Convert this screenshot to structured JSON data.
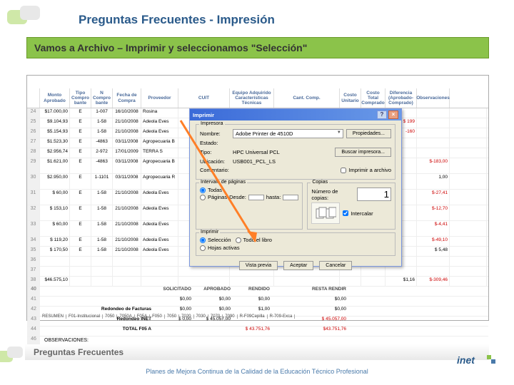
{
  "title": "Preguntas Frecuentes - Impresión",
  "instruction": "Vamos a Archivo – Imprimir y seleccionamos \"Selección\"",
  "headers": [
    "",
    "Monto Aprobado",
    "Tipo Compro bante",
    "N Compro bante",
    "Fecha de Compra",
    "Proveedor",
    "CUIT",
    "Equipo Adquirido Características Técnicas",
    "Cant. Comp.",
    "Costo Unitario",
    "Costo Total Comprado",
    "Diferencia (Aprobado-Comprado)",
    "Observaciones"
  ],
  "rows": [
    {
      "rn": "24",
      "a": "$17.000,00",
      "b": "E",
      "c": "1-007",
      "d": "16/10/2008",
      "e": "Rosina",
      "f": "",
      "g": "",
      "h": "",
      "i": "",
      "j": "",
      "k": "",
      "l": "",
      "m": ""
    },
    {
      "rn": "25",
      "a": "$9.104,93",
      "b": "E",
      "c": "1-58",
      "d": "21/10/2008",
      "e": "Adeola Eves",
      "f": "",
      "g": "",
      "h": "",
      "i": "",
      "j": "",
      "k": "$ 199",
      "l": "",
      "m": "",
      "red_k": true,
      "red_l": true
    },
    {
      "rn": "26",
      "a": "$5.154,93",
      "b": "E",
      "c": "1-58",
      "d": "21/10/2008",
      "e": "Adeola Eves",
      "f": "",
      "g": "",
      "h": "",
      "i": "",
      "j": "",
      "k": "-160",
      "l": "",
      "m": "",
      "red_k": true
    },
    {
      "rn": "27",
      "a": "$1.523,30",
      "b": "E",
      "c": "-4863",
      "d": "03/11/2008",
      "e": "Agropecuaria B",
      "f": "",
      "g": "",
      "h": "",
      "i": "",
      "j": "",
      "k": "",
      "l": "",
      "m": ""
    },
    {
      "rn": "28",
      "a": "$2.956,74",
      "b": "E",
      "c": "2-972",
      "d": "17/01/2009",
      "e": "TERRA S",
      "f": "",
      "g": "",
      "h": "",
      "i": "",
      "j": "",
      "k": "",
      "l": "",
      "m": ""
    },
    {
      "rn": "29",
      "a": "$1.621,00",
      "b": "E",
      "c": "-4863",
      "d": "03/11/2008",
      "e": "Agropecuaria B",
      "f": "",
      "g": "",
      "h": "",
      "i": "",
      "j": "",
      "k": "",
      "l": "$-183,00",
      "m": "",
      "red_l": true,
      "tall": true
    },
    {
      "rn": "30",
      "a": "$2.950,00",
      "b": "E",
      "c": "1-1101",
      "d": "03/11/2008",
      "e": "Agropecuaria R",
      "f": "",
      "g": "",
      "h": "",
      "i": "",
      "j": "",
      "k": "",
      "l": "1,00",
      "m": "",
      "tall": true
    },
    {
      "rn": "31",
      "a": "$ 60,00",
      "b": "E",
      "c": "1-58",
      "d": "21/10/2008",
      "e": "Adeola Eves",
      "f": "",
      "g": "",
      "h": "",
      "i": "",
      "j": "",
      "k": "",
      "l": "$-27,41",
      "m": "",
      "red_l": true,
      "tall": true
    },
    {
      "rn": "32",
      "a": "$ 153,10",
      "b": "E",
      "c": "1-58",
      "d": "21/10/2008",
      "e": "Adeola Eves",
      "f": "",
      "g": "",
      "h": "",
      "i": "",
      "j": "",
      "k": "",
      "l": "$-12,70",
      "m": "",
      "red_l": true,
      "tall": true
    },
    {
      "rn": "33",
      "a": "$ 60,00",
      "b": "E",
      "c": "1-58",
      "d": "21/10/2008",
      "e": "Adeola Eves",
      "f": "",
      "g": "",
      "h": "",
      "i": "",
      "j": "",
      "k": "",
      "l": "$-4,41",
      "m": "",
      "red_l": true,
      "tall": true
    },
    {
      "rn": "34",
      "a": "$ 119,20",
      "b": "E",
      "c": "1-58",
      "d": "21/10/2008",
      "e": "Adeola Eves",
      "f": "",
      "g": "",
      "h": "",
      "i": "",
      "j": "",
      "k": "",
      "l": "$-49,10",
      "m": "",
      "red_l": true
    },
    {
      "rn": "35",
      "a": "$ 170,50",
      "b": "E",
      "c": "1-58",
      "d": "21/10/2008",
      "e": "Adeola Eves",
      "f": "",
      "g": "",
      "h": "",
      "i": "",
      "j": "",
      "k": "",
      "l": "$ 5,48",
      "m": ""
    },
    {
      "rn": "36",
      "a": "",
      "b": "",
      "c": "",
      "d": "",
      "e": "",
      "f": "",
      "g": "",
      "h": "",
      "i": "",
      "j": "",
      "k": "",
      "l": "",
      "m": ""
    },
    {
      "rn": "37",
      "a": "",
      "b": "",
      "c": "",
      "d": "",
      "e": "",
      "f": "",
      "g": "",
      "h": "",
      "i": "",
      "j": "",
      "k": "",
      "l": "",
      "m": ""
    },
    {
      "rn": "38",
      "a": "$46.575,10",
      "b": "",
      "c": "",
      "d": "",
      "e": "",
      "f": "",
      "g": "",
      "h": "",
      "i": "",
      "j": "",
      "k": "$1,16",
      "l": "$-309,46",
      "m": "",
      "red_l": true
    }
  ],
  "summary_head": {
    "rn": "40",
    "sp": "",
    "c1": "SOLICITADO",
    "c2": "APROBADO",
    "c3": "RENDIDO",
    "c4": "RESTA RENDIR"
  },
  "summary": [
    {
      "rn": "41",
      "label": "",
      "c1": "$0,00",
      "c2": "$0,00",
      "c3": "$0,00",
      "c4": "$0,00"
    },
    {
      "rn": "42",
      "label": "Redondeo de Facturas",
      "c1": "$0,00",
      "c2": "$0,00",
      "c3": "$1,00",
      "c4": "$0,00"
    },
    {
      "rn": "43",
      "label": "Redondeo INET",
      "c1": "$ 0,00",
      "c2": "$ 45.057,00",
      "c3": "",
      "c4": "$ 45.057,00",
      "red": true
    },
    {
      "rn": "44",
      "label": "TOTAL F05 A",
      "c1": "",
      "c2": "",
      "c3": "$ 43.751,76",
      "c4": "$43.751,76",
      "red": true
    }
  ],
  "obs": {
    "rn": "46",
    "label": "OBSERVACIONES:"
  },
  "tabs": [
    "RESUMEN",
    "F01-Institucional",
    "7050",
    "7050A",
    "F05A",
    "F050",
    "7050",
    "7020",
    "7030",
    "7070",
    "7090",
    "R-F09Cepilla",
    "R-709-Exca"
  ],
  "dialog": {
    "title": "Imprimir",
    "printer_group": "Impresora",
    "name_label": "Nombre:",
    "name_value": "Adobe Printer de 4510D",
    "status_label": "Estado:",
    "status_value": "",
    "type_label": "Tipo:",
    "type_value": "HPC Universal PCL",
    "where_label": "Ubicación:",
    "where_value": "USB001_PCL_LS",
    "comment_label": "Comentario:",
    "props_btn": "Propiedades...",
    "find_btn": "Buscar impresora...",
    "tofile": "Imprimir a archivo",
    "range_group": "Intervalo de páginas",
    "range_all": "Todas",
    "range_pages": "Páginas",
    "range_from": "Desde:",
    "range_to": "hasta:",
    "copies_group": "Copias",
    "copies_label": "Número de copias:",
    "copies_value": "1",
    "collate": "Intercalar",
    "print_group": "Imprimir",
    "selection": "Selección",
    "active": "Hojas activas",
    "book": "Todo el libro",
    "preview": "Vista previa",
    "ok": "Aceptar",
    "cancel": "Cancelar"
  },
  "footer_label": "Preguntas Frecuentes",
  "footer_caption": "Planes de Mejora Continua de la Calidad de la Educación Técnico Profesional",
  "logo": "inet"
}
